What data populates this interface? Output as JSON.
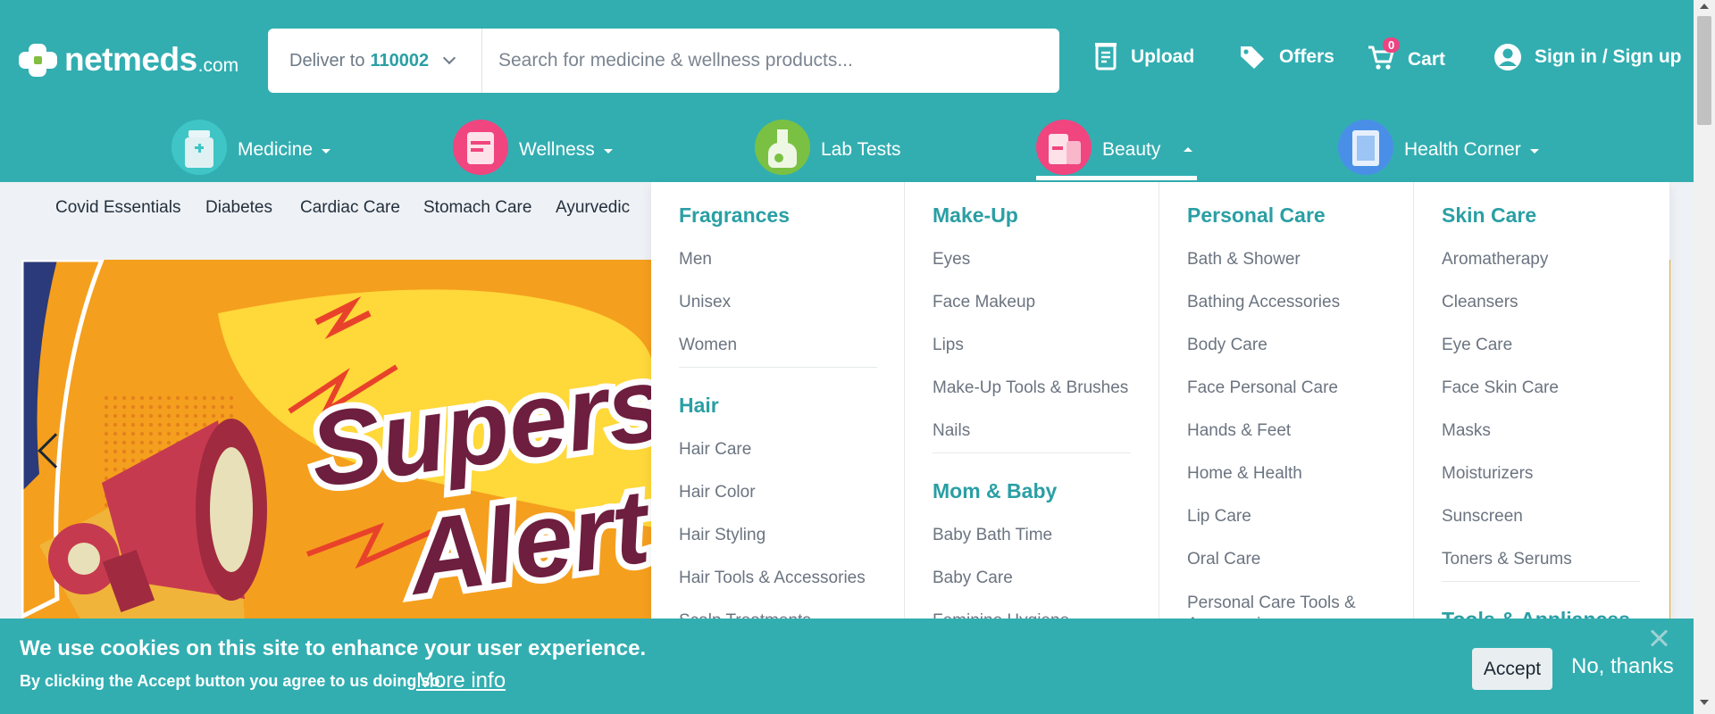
{
  "header": {
    "logo_name": "netmeds",
    "logo_tld": ".com",
    "deliver_label": "Deliver to",
    "pincode": "110002",
    "search_placeholder": "Search for medicine & wellness products...",
    "upload_label": "Upload",
    "offers_label": "Offers",
    "cart_label": "Cart",
    "cart_count": "0",
    "signin_label": "Sign in / Sign up"
  },
  "categories": [
    {
      "label": "Medicine",
      "icon": "medicine-bottle-icon",
      "open": false
    },
    {
      "label": "Wellness",
      "icon": "wellness-icon",
      "open": false
    },
    {
      "label": "Lab Tests",
      "icon": "lab-flask-icon",
      "open": false
    },
    {
      "label": "Beauty",
      "icon": "beauty-icon",
      "open": true
    },
    {
      "label": "Health Corner",
      "icon": "health-corner-icon",
      "open": false
    }
  ],
  "subnav": [
    "Covid Essentials",
    "Diabetes",
    "Cardiac Care",
    "Stomach Care",
    "Ayurvedic"
  ],
  "banner": {
    "line1": "Supersa",
    "line2": "Alert"
  },
  "beauty_menu": {
    "col1": {
      "group1": {
        "title": "Fragrances",
        "items": [
          "Men",
          "Unisex",
          "Women"
        ]
      },
      "group2": {
        "title": "Hair",
        "items": [
          "Hair Care",
          "Hair Color",
          "Hair Styling",
          "Hair Tools & Accessories",
          "Scalp Treatments"
        ]
      }
    },
    "col2": {
      "group1": {
        "title": "Make-Up",
        "items": [
          "Eyes",
          "Face Makeup",
          "Lips",
          "Make-Up Tools & Brushes",
          "Nails"
        ]
      },
      "group2": {
        "title": "Mom & Baby",
        "items": [
          "Baby Bath Time",
          "Baby Care",
          "Feminine Hygiene"
        ]
      }
    },
    "col3": {
      "group1": {
        "title": "Personal Care",
        "items": [
          "Bath & Shower",
          "Bathing Accessories",
          "Body Care",
          "Face Personal Care",
          "Hands & Feet",
          "Home & Health",
          "Lip Care",
          "Oral Care",
          "Personal Care Tools & Accessories"
        ]
      }
    },
    "col4": {
      "group1": {
        "title": "Skin Care",
        "items": [
          "Aromatherapy",
          "Cleansers",
          "Eye Care",
          "Face Skin Care",
          "Masks",
          "Moisturizers",
          "Sunscreen",
          "Toners & Serums"
        ]
      },
      "group2": {
        "title": "Tools & Appliances",
        "items": []
      }
    }
  },
  "cookie": {
    "title": "We use cookies on this site to enhance your user experience.",
    "body": "By clicking the Accept button you agree to us doing so.",
    "more_info": "More info",
    "accept": "Accept",
    "no_thanks": "No, thanks"
  },
  "colors": {
    "brand": "#32aeb1",
    "accent_text": "#2a9fa4",
    "badge": "#ef4281",
    "logo_green": "#84be41"
  }
}
